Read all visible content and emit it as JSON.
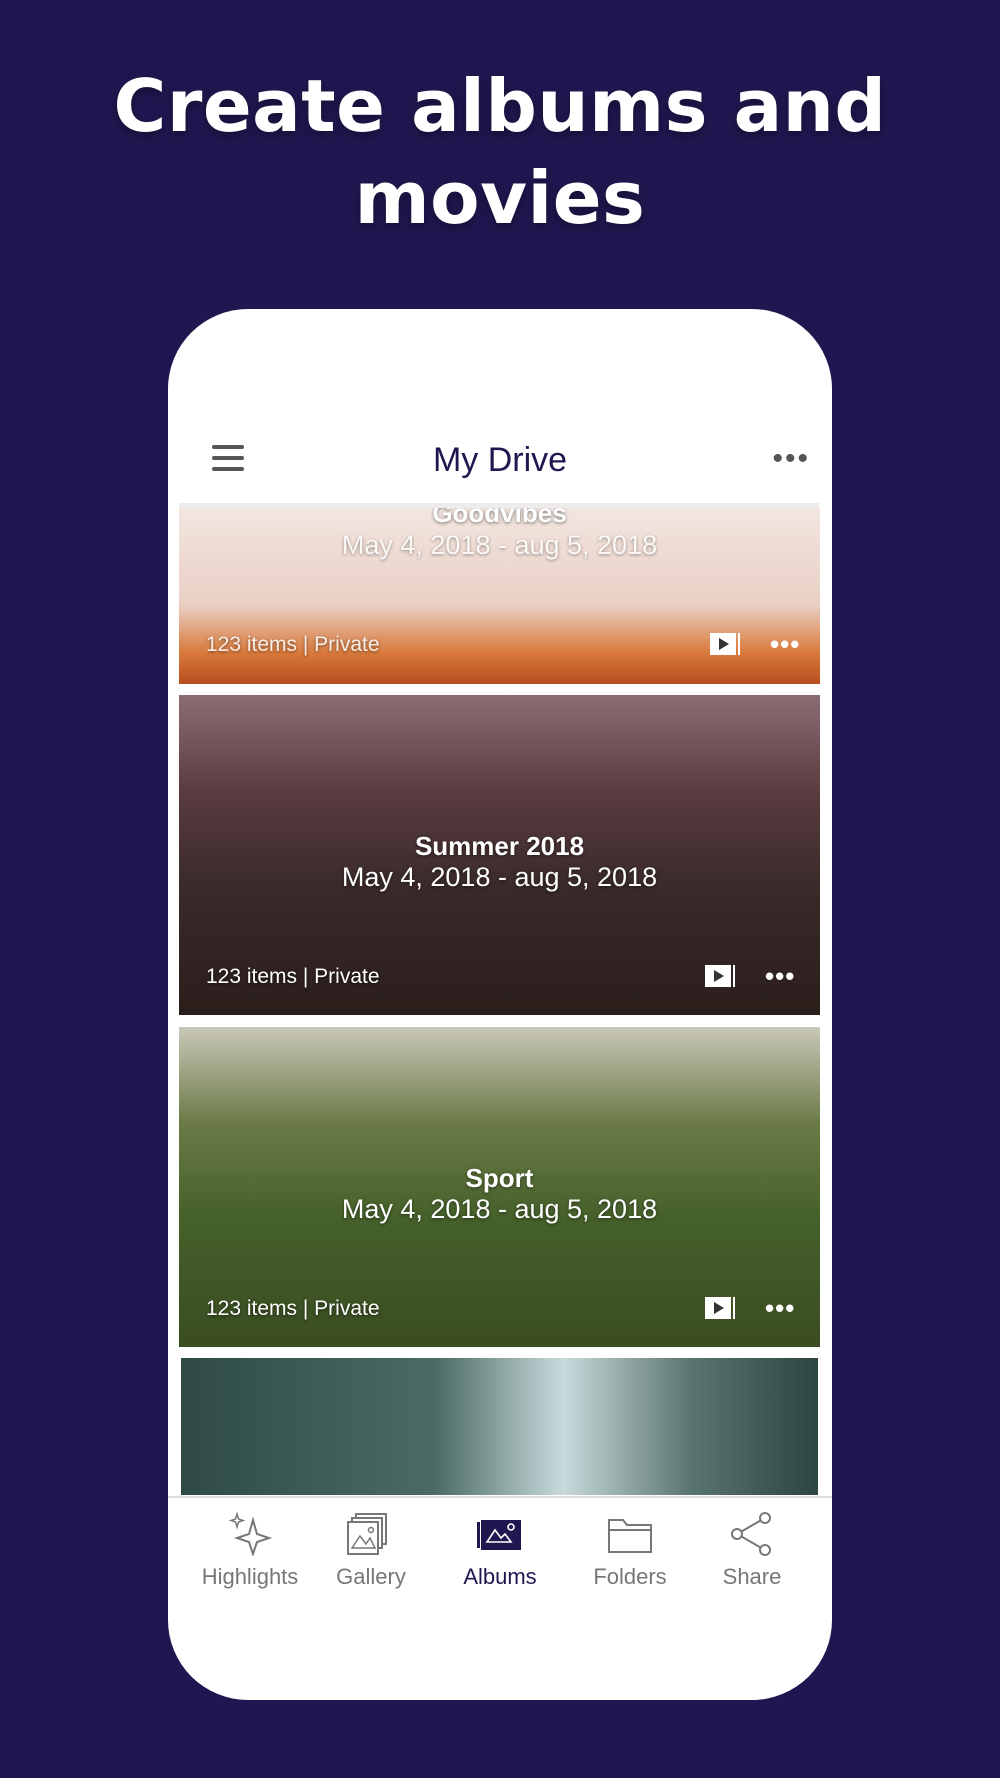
{
  "headline": {
    "line1": "Create albums and",
    "line2": "movies"
  },
  "header": {
    "title": "My Drive",
    "menu_icon": "hamburger-menu-icon",
    "more_icon": "more-dots-icon"
  },
  "albums": [
    {
      "name": "Goodvibes",
      "dates": "May 4, 2018 - aug 5, 2018",
      "meta": "123 items | Private"
    },
    {
      "name": "Summer 2018",
      "dates": "May 4, 2018 - aug 5, 2018",
      "meta": "123 items | Private"
    },
    {
      "name": "Sport",
      "dates": "May 4, 2018 - aug 5, 2018",
      "meta": "123 items | Private"
    },
    {
      "name": "",
      "dates": "",
      "meta": ""
    }
  ],
  "tabs": [
    {
      "label": "Highlights",
      "icon": "sparkle-icon"
    },
    {
      "label": "Gallery",
      "icon": "gallery-icon"
    },
    {
      "label": "Albums",
      "icon": "albums-icon",
      "active": true
    },
    {
      "label": "Folders",
      "icon": "folder-icon"
    },
    {
      "label": "Share",
      "icon": "share-icon"
    }
  ],
  "colors": {
    "background": "#1f1850",
    "accent": "#1f1850",
    "inactive": "#777777"
  }
}
